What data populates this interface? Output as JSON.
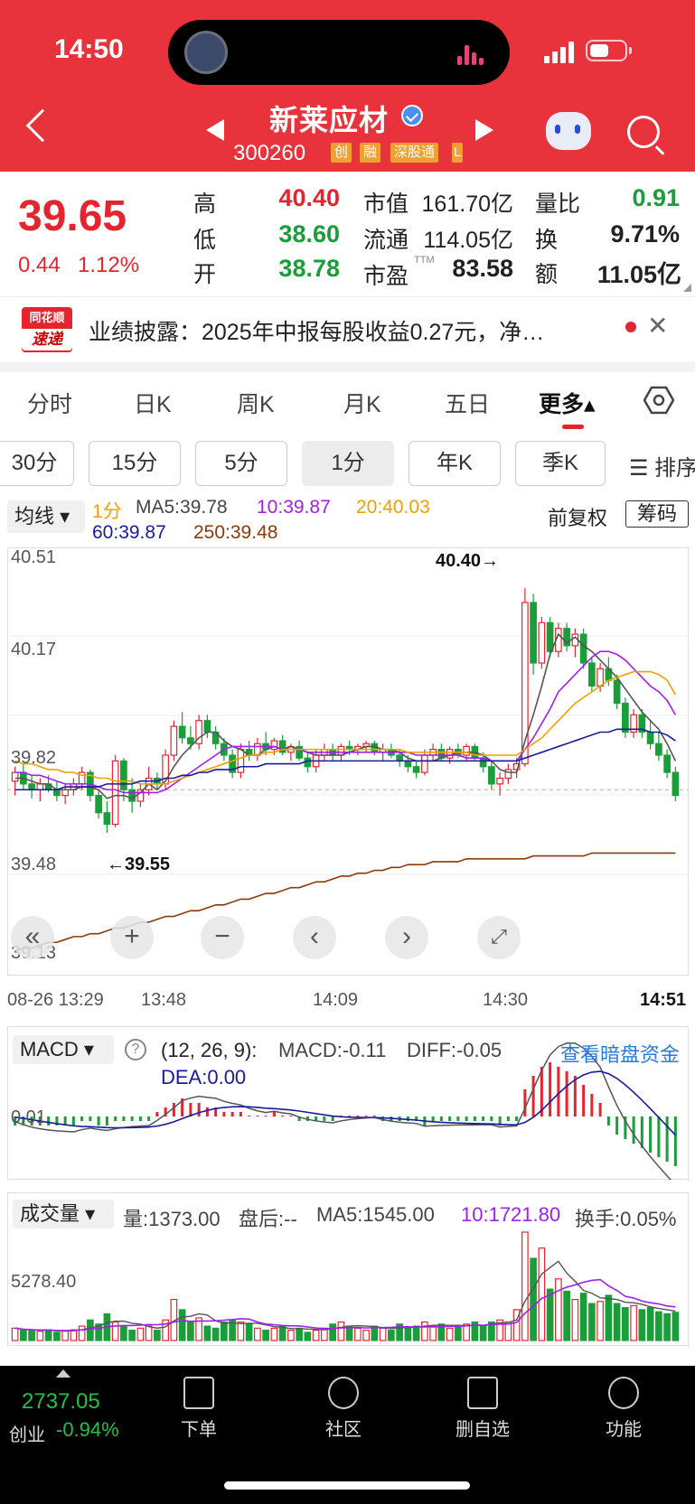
{
  "status": {
    "time": "14:50"
  },
  "stock": {
    "name": "新莱应材",
    "code": "300260",
    "tags": [
      "创",
      "融",
      "深股通",
      "L"
    ],
    "price": "39.65",
    "change": "0.44",
    "change_pct": "1.12%",
    "high_label": "高",
    "high": "40.40",
    "low_label": "低",
    "low": "38.60",
    "open_label": "开",
    "open": "38.78",
    "mktcap_label": "市值",
    "mktcap": "161.70亿",
    "float_label": "流通",
    "float": "114.05亿",
    "pe_label": "市盈",
    "pe_sup": "TTM",
    "pe": "83.58",
    "volratio_label": "量比",
    "volratio": "0.91",
    "turnover_label": "换",
    "turnover": "9.71%",
    "amount_label": "额",
    "amount": "11.05亿"
  },
  "news": {
    "logo_top": "同花顺",
    "logo_bottom": "速递",
    "text": "业绩披露：2025年中报每股收益0.27元，净…",
    "close": "✕"
  },
  "period_tabs": [
    "分时",
    "日K",
    "周K",
    "月K",
    "五日",
    "更多▴"
  ],
  "sub_tabs": [
    "30分",
    "15分",
    "5分",
    "1分",
    "年K",
    "季K"
  ],
  "sort_label": "☰ 排序",
  "ma": {
    "selector": "均线 ▾",
    "period": "1分",
    "ma5": "MA5:39.78",
    "ma10": "10:39.87",
    "ma20": "20:40.03",
    "ma60": "60:39.87",
    "ma250": "250:39.48"
  },
  "adjust": {
    "fq": "前复权",
    "chouma": "筹码"
  },
  "colors": {
    "up": "#e4252f",
    "down": "#1a9e3a",
    "ma5": "#555555",
    "ma10": "#a020f0",
    "ma20": "#f0a000",
    "ma60": "#1a1a9e",
    "ma250": "#8b3a0a"
  },
  "chart_data": [
    {
      "type": "candlestick",
      "title": "1分",
      "y_ticks": [
        "40.51",
        "40.17",
        "39.82",
        "39.48",
        "39.13"
      ],
      "ylim": [
        39.13,
        40.51
      ],
      "annotations": [
        "40.40→",
        "←39.55"
      ],
      "x_ticks": [
        "08-26 13:29",
        "13:48",
        "14:09",
        "14:30",
        "14:51"
      ],
      "candles": [
        [
          39.73,
          39.78,
          39.68,
          39.76
        ],
        [
          39.76,
          39.79,
          39.7,
          39.72
        ],
        [
          39.72,
          39.75,
          39.67,
          39.7
        ],
        [
          39.7,
          39.74,
          39.66,
          39.72
        ],
        [
          39.72,
          39.75,
          39.69,
          39.7
        ],
        [
          39.7,
          39.73,
          39.66,
          39.68
        ],
        [
          39.68,
          39.72,
          39.65,
          39.7
        ],
        [
          39.7,
          39.74,
          39.68,
          39.72
        ],
        [
          39.72,
          39.78,
          39.7,
          39.76
        ],
        [
          39.76,
          39.77,
          39.66,
          39.68
        ],
        [
          39.68,
          39.7,
          39.6,
          39.62
        ],
        [
          39.62,
          39.66,
          39.55,
          39.58
        ],
        [
          39.58,
          39.82,
          39.57,
          39.8
        ],
        [
          39.8,
          39.81,
          39.66,
          39.7
        ],
        [
          39.7,
          39.74,
          39.62,
          39.66
        ],
        [
          39.66,
          39.72,
          39.64,
          39.7
        ],
        [
          39.7,
          39.78,
          39.68,
          39.74
        ],
        [
          39.74,
          39.76,
          39.7,
          39.72
        ],
        [
          39.72,
          39.84,
          39.7,
          39.82
        ],
        [
          39.82,
          39.94,
          39.8,
          39.92
        ],
        [
          39.92,
          39.97,
          39.86,
          39.88
        ],
        [
          39.88,
          39.92,
          39.84,
          39.86
        ],
        [
          39.86,
          39.96,
          39.84,
          39.94
        ],
        [
          39.94,
          39.96,
          39.88,
          39.9
        ],
        [
          39.9,
          39.92,
          39.84,
          39.86
        ],
        [
          39.86,
          39.88,
          39.8,
          39.82
        ],
        [
          39.82,
          39.84,
          39.74,
          39.76
        ],
        [
          39.76,
          39.86,
          39.74,
          39.84
        ],
        [
          39.84,
          39.87,
          39.8,
          39.82
        ],
        [
          39.82,
          39.88,
          39.8,
          39.86
        ],
        [
          39.86,
          39.9,
          39.82,
          39.84
        ],
        [
          39.84,
          39.88,
          39.82,
          39.87
        ],
        [
          39.87,
          39.89,
          39.82,
          39.83
        ],
        [
          39.83,
          39.86,
          39.8,
          39.85
        ],
        [
          39.85,
          39.87,
          39.8,
          39.81
        ],
        [
          39.81,
          39.83,
          39.76,
          39.78
        ],
        [
          39.78,
          39.84,
          39.76,
          39.82
        ],
        [
          39.82,
          39.86,
          39.8,
          39.84
        ],
        [
          39.84,
          39.86,
          39.8,
          39.82
        ],
        [
          39.82,
          39.86,
          39.8,
          39.85
        ],
        [
          39.85,
          39.87,
          39.82,
          39.84
        ],
        [
          39.84,
          39.86,
          39.82,
          39.85
        ],
        [
          39.85,
          39.87,
          39.83,
          39.86
        ],
        [
          39.86,
          39.87,
          39.82,
          39.83
        ],
        [
          39.83,
          39.86,
          39.8,
          39.84
        ],
        [
          39.84,
          39.86,
          39.81,
          39.82
        ],
        [
          39.82,
          39.84,
          39.78,
          39.8
        ],
        [
          39.8,
          39.82,
          39.76,
          39.78
        ],
        [
          39.78,
          39.8,
          39.74,
          39.76
        ],
        [
          39.76,
          39.84,
          39.75,
          39.82
        ],
        [
          39.82,
          39.86,
          39.8,
          39.84
        ],
        [
          39.84,
          39.86,
          39.8,
          39.81
        ],
        [
          39.81,
          39.85,
          39.79,
          39.84
        ],
        [
          39.84,
          39.86,
          39.81,
          39.82
        ],
        [
          39.82,
          39.86,
          39.8,
          39.85
        ],
        [
          39.85,
          39.86,
          39.8,
          39.81
        ],
        [
          39.81,
          39.83,
          39.76,
          39.78
        ],
        [
          39.78,
          39.8,
          39.7,
          39.72
        ],
        [
          39.72,
          39.76,
          39.68,
          39.74
        ],
        [
          39.74,
          39.79,
          39.72,
          39.77
        ],
        [
          39.77,
          39.81,
          39.74,
          39.79
        ],
        [
          39.79,
          40.4,
          39.78,
          40.35
        ],
        [
          40.35,
          40.38,
          40.1,
          40.14
        ],
        [
          40.14,
          40.3,
          40.12,
          40.28
        ],
        [
          40.28,
          40.3,
          40.16,
          40.18
        ],
        [
          40.18,
          40.28,
          40.16,
          40.26
        ],
        [
          40.26,
          40.28,
          40.18,
          40.2
        ],
        [
          40.2,
          40.26,
          40.16,
          40.24
        ],
        [
          40.24,
          40.26,
          40.12,
          40.14
        ],
        [
          40.14,
          40.16,
          40.04,
          40.06
        ],
        [
          40.06,
          40.14,
          40.04,
          40.12
        ],
        [
          40.12,
          40.16,
          40.06,
          40.08
        ],
        [
          40.08,
          40.1,
          39.98,
          40.0
        ],
        [
          40.0,
          40.02,
          39.88,
          39.9
        ],
        [
          39.9,
          39.98,
          39.88,
          39.96
        ],
        [
          39.96,
          39.98,
          39.88,
          39.9
        ],
        [
          39.9,
          39.94,
          39.84,
          39.86
        ],
        [
          39.86,
          39.9,
          39.8,
          39.82
        ],
        [
          39.82,
          39.84,
          39.74,
          39.76
        ],
        [
          39.76,
          39.78,
          39.66,
          39.68
        ]
      ],
      "ma5": [
        39.74,
        39.74,
        39.73,
        39.72,
        39.72,
        39.7,
        39.7,
        39.7,
        39.71,
        39.71,
        39.7,
        39.67,
        39.68,
        39.68,
        39.67,
        39.69,
        39.72,
        39.7,
        39.73,
        39.78,
        39.82,
        39.85,
        39.88,
        39.9,
        39.9,
        39.87,
        39.85,
        39.84,
        39.82,
        39.82,
        39.84,
        39.85,
        39.84,
        39.85,
        39.84,
        39.83,
        39.82,
        39.82,
        39.82,
        39.82,
        39.83,
        39.84,
        39.85,
        39.85,
        39.84,
        39.84,
        39.83,
        39.81,
        39.8,
        39.8,
        39.8,
        39.81,
        39.82,
        39.83,
        39.83,
        39.83,
        39.82,
        39.8,
        39.77,
        39.76,
        39.76,
        39.87,
        39.96,
        40.06,
        40.17,
        40.24,
        40.21,
        40.23,
        40.2,
        40.18,
        40.15,
        40.12,
        40.09,
        40.05,
        40.01,
        39.97,
        39.94,
        39.91,
        39.86,
        39.8
      ],
      "ma10": [
        39.76,
        39.76,
        39.75,
        39.75,
        39.74,
        39.73,
        39.72,
        39.72,
        39.72,
        39.72,
        39.71,
        39.7,
        39.7,
        39.69,
        39.69,
        39.69,
        39.69,
        39.69,
        39.7,
        39.72,
        39.74,
        39.76,
        39.78,
        39.8,
        39.82,
        39.84,
        39.85,
        39.85,
        39.85,
        39.85,
        39.85,
        39.85,
        39.84,
        39.84,
        39.84,
        39.83,
        39.83,
        39.83,
        39.83,
        39.83,
        39.83,
        39.83,
        39.83,
        39.83,
        39.83,
        39.83,
        39.83,
        39.83,
        39.82,
        39.82,
        39.82,
        39.82,
        39.82,
        39.82,
        39.81,
        39.81,
        39.81,
        39.8,
        39.8,
        39.8,
        39.8,
        39.84,
        39.88,
        39.93,
        39.98,
        40.04,
        40.07,
        40.1,
        40.13,
        40.16,
        40.18,
        40.18,
        40.17,
        40.15,
        40.12,
        40.09,
        40.06,
        40.04,
        40.01,
        39.96
      ],
      "ma20": [
        39.8,
        39.79,
        39.79,
        39.78,
        39.77,
        39.77,
        39.76,
        39.76,
        39.75,
        39.75,
        39.74,
        39.74,
        39.73,
        39.73,
        39.73,
        39.72,
        39.72,
        39.72,
        39.72,
        39.73,
        39.74,
        39.75,
        39.76,
        39.77,
        39.78,
        39.79,
        39.8,
        39.81,
        39.82,
        39.82,
        39.83,
        39.83,
        39.84,
        39.84,
        39.84,
        39.84,
        39.84,
        39.84,
        39.84,
        39.84,
        39.84,
        39.84,
        39.84,
        39.84,
        39.84,
        39.84,
        39.84,
        39.83,
        39.83,
        39.83,
        39.83,
        39.83,
        39.83,
        39.83,
        39.83,
        39.82,
        39.82,
        39.82,
        39.82,
        39.82,
        39.82,
        39.84,
        39.86,
        39.88,
        39.91,
        39.94,
        39.97,
        40.0,
        40.02,
        40.04,
        40.06,
        40.08,
        40.09,
        40.1,
        40.11,
        40.11,
        40.11,
        40.1,
        40.08,
        40.03
      ],
      "ma60": [
        39.7,
        39.7,
        39.7,
        39.7,
        39.7,
        39.7,
        39.71,
        39.71,
        39.71,
        39.71,
        39.71,
        39.72,
        39.72,
        39.72,
        39.72,
        39.73,
        39.73,
        39.73,
        39.74,
        39.74,
        39.75,
        39.75,
        39.76,
        39.76,
        39.77,
        39.77,
        39.77,
        39.78,
        39.78,
        39.78,
        39.79,
        39.79,
        39.79,
        39.79,
        39.79,
        39.8,
        39.8,
        39.8,
        39.8,
        39.8,
        39.8,
        39.8,
        39.8,
        39.8,
        39.8,
        39.8,
        39.8,
        39.8,
        39.8,
        39.8,
        39.8,
        39.8,
        39.8,
        39.8,
        39.8,
        39.8,
        39.8,
        39.8,
        39.8,
        39.8,
        39.8,
        39.81,
        39.82,
        39.83,
        39.84,
        39.85,
        39.86,
        39.87,
        39.88,
        39.89,
        39.9,
        39.9,
        39.91,
        39.91,
        39.91,
        39.91,
        39.9,
        39.9,
        39.89,
        39.87
      ],
      "ma250": [
        39.14,
        39.15,
        39.15,
        39.16,
        39.17,
        39.17,
        39.18,
        39.19,
        39.19,
        39.2,
        39.2,
        39.21,
        39.22,
        39.22,
        39.23,
        39.24,
        39.24,
        39.25,
        39.26,
        39.26,
        39.27,
        39.28,
        39.28,
        39.29,
        39.3,
        39.3,
        39.31,
        39.32,
        39.32,
        39.33,
        39.34,
        39.34,
        39.35,
        39.36,
        39.36,
        39.37,
        39.38,
        39.38,
        39.39,
        39.4,
        39.4,
        39.41,
        39.41,
        39.42,
        39.42,
        39.43,
        39.43,
        39.44,
        39.44,
        39.44,
        39.45,
        39.45,
        39.45,
        39.45,
        39.46,
        39.46,
        39.46,
        39.46,
        39.46,
        39.46,
        39.46,
        39.46,
        39.47,
        39.47,
        39.47,
        39.47,
        39.47,
        39.47,
        39.47,
        39.48,
        39.48,
        39.48,
        39.48,
        39.48,
        39.48,
        39.48,
        39.48,
        39.48,
        39.48,
        39.48
      ]
    },
    {
      "type": "bar",
      "title": "MACD",
      "params": "(12, 26, 9):",
      "macd_label": "MACD:-0.11",
      "diff_label": "DIFF:-0.05",
      "dea_label": "DEA:0.00",
      "link": "查看暗盘资金",
      "y_ticks": [
        "0.01"
      ],
      "values": [
        -0.02,
        -0.02,
        -0.02,
        -0.02,
        -0.02,
        -0.02,
        -0.02,
        -0.02,
        -0.01,
        -0.01,
        -0.02,
        -0.02,
        -0.01,
        -0.01,
        -0.01,
        -0.01,
        -0.01,
        0.01,
        0.02,
        0.03,
        0.04,
        0.03,
        0.03,
        0.02,
        0.02,
        0.01,
        0.01,
        0.01,
        0.0,
        0.0,
        0.0,
        0.01,
        0.0,
        0.0,
        -0.01,
        -0.01,
        -0.01,
        -0.01,
        -0.01,
        0.0,
        0.0,
        0.0,
        0.0,
        0.0,
        -0.01,
        -0.01,
        -0.01,
        -0.01,
        -0.01,
        -0.02,
        -0.01,
        -0.01,
        -0.01,
        -0.01,
        -0.01,
        -0.01,
        -0.01,
        -0.01,
        -0.02,
        -0.01,
        -0.01,
        0.06,
        0.09,
        0.11,
        0.12,
        0.11,
        0.1,
        0.09,
        0.07,
        0.05,
        0.03,
        -0.02,
        -0.04,
        -0.05,
        -0.06,
        -0.07,
        -0.08,
        -0.09,
        -0.1,
        -0.11
      ]
    },
    {
      "type": "bar",
      "title": "成交量",
      "vol_label": "量:1373.00",
      "after_label": "盘后:--",
      "ma5_label": "MA5:1545.00",
      "ma10_label": "10:1721.80",
      "turn_label": "换手:0.05%",
      "y_ticks": [
        "5278.40"
      ],
      "values": [
        600,
        500,
        480,
        450,
        520,
        400,
        460,
        520,
        700,
        1000,
        800,
        1300,
        900,
        700,
        500,
        600,
        700,
        500,
        1000,
        2000,
        1500,
        900,
        1100,
        700,
        600,
        900,
        1000,
        900,
        800,
        600,
        500,
        600,
        700,
        500,
        600,
        400,
        500,
        600,
        800,
        900,
        700,
        600,
        500,
        700,
        600,
        500,
        800,
        600,
        700,
        900,
        700,
        800,
        600,
        700,
        800,
        900,
        700,
        900,
        1000,
        900,
        1500,
        5278,
        4000,
        4500,
        2500,
        3000,
        2400,
        2000,
        2300,
        1800,
        1900,
        2200,
        1800,
        1600,
        1700,
        1500,
        1600,
        1400,
        1300,
        1373
      ]
    }
  ],
  "bottom_nav": {
    "index_value": "2737.05",
    "index_name": "创业",
    "index_change": "-0.94%",
    "items": [
      "下单",
      "社区",
      "删自选",
      "功能"
    ]
  }
}
